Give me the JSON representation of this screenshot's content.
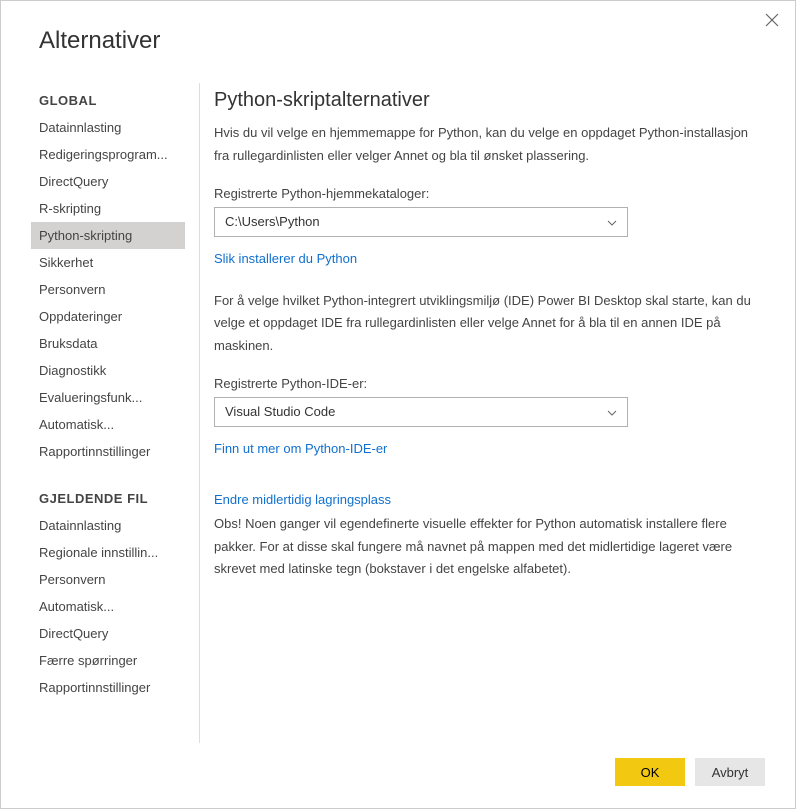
{
  "dialog": {
    "title": "Alternativer"
  },
  "sidebar": {
    "sections": [
      {
        "header": "GLOBAL",
        "items": [
          {
            "label": "Datainnlasting",
            "key": "global-datainnlasting"
          },
          {
            "label": "Redigeringsprogram...",
            "key": "redigeringsprogram"
          },
          {
            "label": "DirectQuery",
            "key": "global-directquery"
          },
          {
            "label": "R-skripting",
            "key": "r-skripting"
          },
          {
            "label": "Python-skripting",
            "key": "python-skripting",
            "selected": true
          },
          {
            "label": "Sikkerhet",
            "key": "sikkerhet"
          },
          {
            "label": "Personvern",
            "key": "global-personvern"
          },
          {
            "label": "Oppdateringer",
            "key": "oppdateringer"
          },
          {
            "label": "Bruksdata",
            "key": "bruksdata"
          },
          {
            "label": "Diagnostikk",
            "key": "diagnostikk"
          },
          {
            "label": "Evalueringsfunk...",
            "key": "evalueringsfunk"
          },
          {
            "label": "Automatisk...",
            "key": "global-automatisk"
          },
          {
            "label": "Rapportinnstillinger",
            "key": "global-rapportinnstillinger"
          }
        ]
      },
      {
        "header": "GJELDENDE FIL",
        "items": [
          {
            "label": "Datainnlasting",
            "key": "file-datainnlasting"
          },
          {
            "label": "Regionale innstillin...",
            "key": "regionale"
          },
          {
            "label": "Personvern",
            "key": "file-personvern"
          },
          {
            "label": "Automatisk...",
            "key": "file-automatisk"
          },
          {
            "label": "DirectQuery",
            "key": "file-directquery"
          },
          {
            "label": "Færre spørringer",
            "key": "faerre"
          },
          {
            "label": "Rapportinnstillinger",
            "key": "file-rapportinnstillinger"
          }
        ]
      }
    ]
  },
  "main": {
    "title": "Python-skriptalternativer",
    "intro": "Hvis du vil velge en hjemmemappe for Python, kan du velge en oppdaget Python-installasjon fra rullegardinlisten eller velger Annet og bla til ønsket plassering.",
    "home_dir_label": "Registrerte Python-hjemmekataloger:",
    "home_dir_value": "C:\\Users\\Python",
    "install_link": "Slik installerer du Python",
    "ide_intro": "For å velge hvilket Python-integrert utviklingsmiljø (IDE) Power BI Desktop skal starte, kan du velge et oppdaget IDE fra rullegardinlisten eller velge Annet for å bla til en annen IDE på maskinen.",
    "ide_label": "Registrerte Python-IDE-er:",
    "ide_value": "Visual Studio Code",
    "ide_link": "Finn ut mer om Python-IDE-er",
    "temp_link": "Endre midlertidig lagringsplass",
    "temp_note": "Obs! Noen ganger vil egendefinerte visuelle effekter for Python automatisk installere flere pakker. For at disse skal fungere må navnet på mappen med det midlertidige lageret være skrevet med latinske tegn (bokstaver i det engelske alfabetet)."
  },
  "footer": {
    "ok": "OK",
    "cancel": "Avbryt"
  }
}
